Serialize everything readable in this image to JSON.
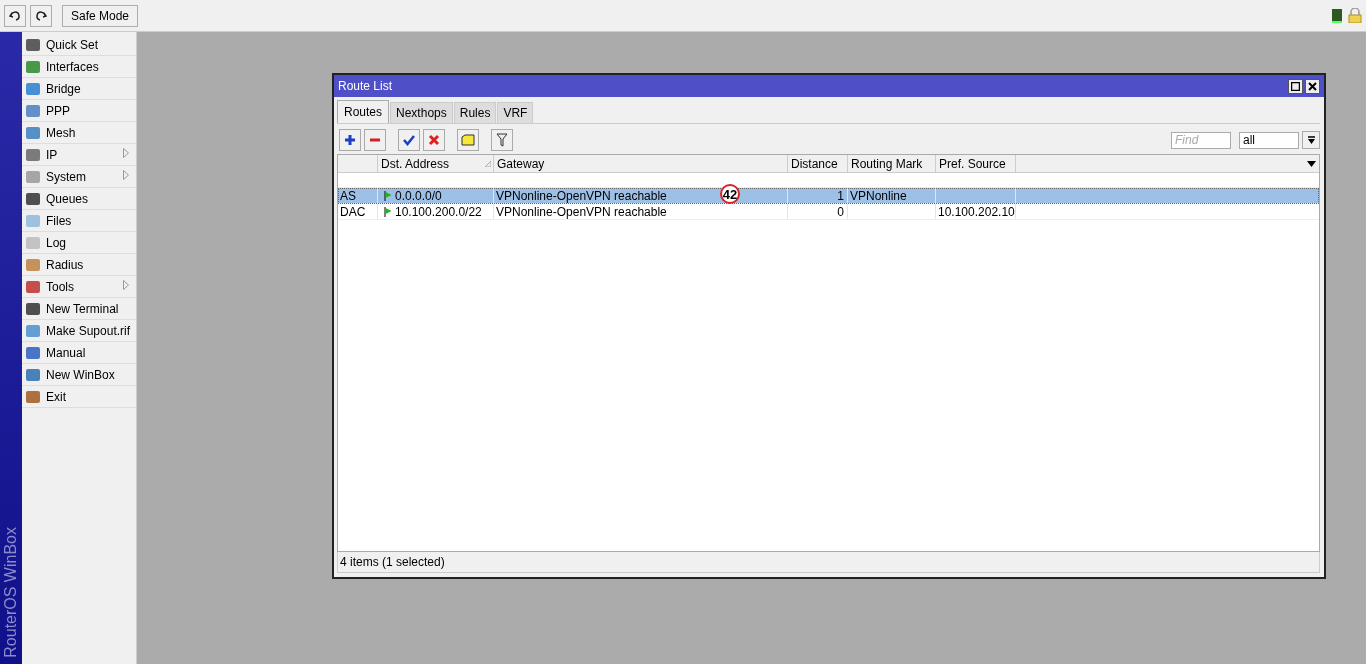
{
  "toolbar": {
    "safe_mode": "Safe Mode"
  },
  "sidebar": {
    "brand": "RouterOS WinBox",
    "items": [
      {
        "label": "Quick Set",
        "submenu": false
      },
      {
        "label": "Interfaces",
        "submenu": false
      },
      {
        "label": "Bridge",
        "submenu": false
      },
      {
        "label": "PPP",
        "submenu": false
      },
      {
        "label": "Mesh",
        "submenu": false
      },
      {
        "label": "IP",
        "submenu": true
      },
      {
        "label": "System",
        "submenu": true
      },
      {
        "label": "Queues",
        "submenu": false
      },
      {
        "label": "Files",
        "submenu": false
      },
      {
        "label": "Log",
        "submenu": false
      },
      {
        "label": "Radius",
        "submenu": false
      },
      {
        "label": "Tools",
        "submenu": true
      },
      {
        "label": "New Terminal",
        "submenu": false
      },
      {
        "label": "Make Supout.rif",
        "submenu": false
      },
      {
        "label": "Manual",
        "submenu": false
      },
      {
        "label": "New WinBox",
        "submenu": false
      },
      {
        "label": "Exit",
        "submenu": false
      }
    ]
  },
  "window": {
    "title": "Route List",
    "tabs": [
      {
        "label": "Routes",
        "selected": true
      },
      {
        "label": "Nexthops",
        "selected": false
      },
      {
        "label": "Rules",
        "selected": false
      },
      {
        "label": "VRF",
        "selected": false
      }
    ],
    "find": {
      "placeholder": "Find"
    },
    "filter": {
      "value": "all"
    },
    "table": {
      "columns": [
        {
          "sorted": false
        },
        {
          "label": "Dst. Address",
          "sorted": true
        },
        {
          "label": "Gateway",
          "sorted": false
        },
        {
          "label": "Distance",
          "sorted": false
        },
        {
          "label": "Routing Mark",
          "sorted": false
        },
        {
          "label": "Pref. Source",
          "sorted": false
        }
      ],
      "rows": [
        {
          "flags": "AS",
          "dst": "0.0.0.0/0",
          "gateway": "VPNonline-OpenVPN reachable",
          "distance": "1",
          "routing_mark": "VPNonline",
          "pref_source": "",
          "selected": true,
          "badge": "42"
        },
        {
          "flags": "DAC",
          "dst": "10.100.200.0/22",
          "gateway": "VPNonline-OpenVPN reachable",
          "distance": "0",
          "routing_mark": "",
          "pref_source": "10.100.202.10",
          "selected": false,
          "badge": ""
        }
      ]
    },
    "status": "4 items (1 selected)"
  }
}
